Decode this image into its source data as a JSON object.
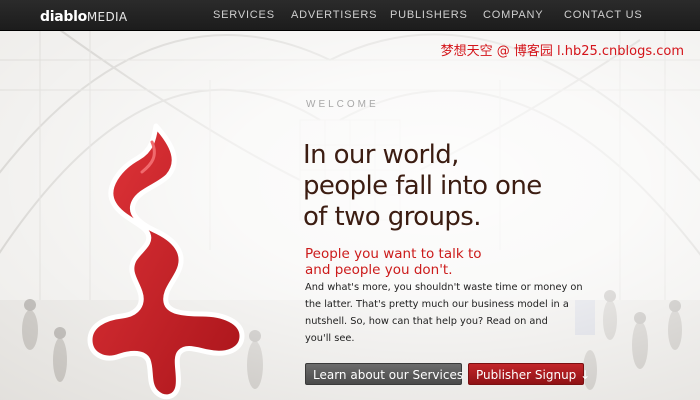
{
  "header": {
    "logo_bold": "diablo",
    "logo_light": "MEDIA",
    "nav": [
      {
        "label": "SERVICES"
      },
      {
        "label": "ADVERTISERS"
      },
      {
        "label": "PUBLISHERS"
      },
      {
        "label": "COMPANY"
      },
      {
        "label": "CONTACT US"
      }
    ]
  },
  "watermark": "梦想天空 @ 博客园 l.hb25.cnblogs.com",
  "main": {
    "welcome": "WELCOME",
    "headline": [
      "In our world,",
      "people fall into one",
      "of two groups."
    ],
    "subhead": [
      "People you want to talk to",
      "and people you don't."
    ],
    "body": [
      "And what's more, you shouldn't waste time or money on",
      "the latter. That's pretty much our business model in a",
      "nutshell. So, how can that help you? Read on and",
      "you'll see."
    ],
    "buttons": {
      "services": "Learn about our Services ↓",
      "publisher": "Publisher Signup ↓"
    }
  },
  "colors": {
    "brand_red": "#cc1b1b",
    "headline_brown": "#3c1d12",
    "nav_bg": "#1f1f1f"
  },
  "icons": {
    "mascot": "red-squiggle-mascot"
  }
}
